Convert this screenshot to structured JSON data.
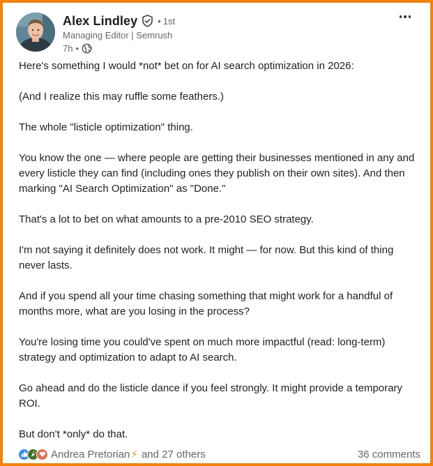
{
  "post": {
    "author": {
      "name": "Alex Lindley",
      "degree": "1st",
      "headline": "Managing Editor | Semrush",
      "time": "7h"
    },
    "paragraphs": [
      "Here's something I would *not* bet on for AI search optimization in 2026:",
      "(And I realize this may ruffle some feathers.)",
      "The whole \"listicle optimization\" thing.",
      "You know the one — where people are getting their businesses mentioned in any and every listicle they can find (including ones they publish on their own sites). And then marking \"AI Search Optimization\" as \"Done.\"",
      "That's a lot to bet on what amounts to a pre-2010 SEO strategy.",
      "I'm not saying it definitely does not work. It might — for now. But this kind of thing never lasts.",
      "And if you spend all your time chasing something that might work for a handful of months more, what are you losing in the process?",
      "You're losing time you could've spent on much more impactful (read: long-term) strategy and optimization to adapt to AI search.",
      "Go ahead and do the listicle dance if you feel strongly. It might provide a temporary ROI.",
      "But don't *only* do that."
    ],
    "social": {
      "reactor": "Andrea Pretorian",
      "others": "and 27 others",
      "comments": "36 comments",
      "reaction_icons": [
        "like-icon",
        "celebrate-icon",
        "love-icon"
      ]
    }
  },
  "colors": {
    "frame_border": "#f5820d",
    "like": "#378fe9",
    "celebrate": "#44712e",
    "love": "#df704d"
  }
}
